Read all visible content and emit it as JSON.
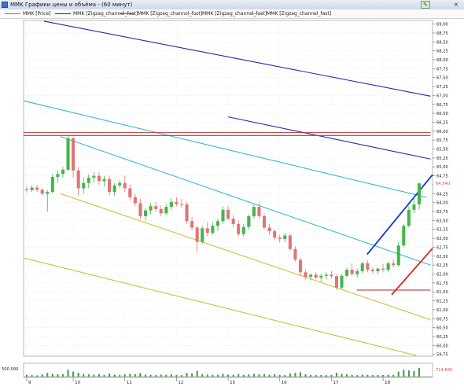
{
  "window": {
    "title": "MMK Графики цены и объёма - (60 минут)",
    "close_glyph": "×"
  },
  "legend": [
    {
      "label": "MMK [Price]",
      "color": "#7f7f7f"
    },
    {
      "label": "MMK [Zigzag_channel_fast]",
      "color": "#1f2aa8"
    },
    {
      "label": "MMK [Zigzag_channel_fast]",
      "color": "#b73737"
    },
    {
      "label": "MMK [Zigzag_channel_fast]",
      "color": "#c9c23a"
    },
    {
      "label": "MMK [Zigzag_channel_fast]",
      "color": "#3ab8c9"
    }
  ],
  "colors": {
    "up_candle": "#43b64a",
    "down_candle": "#e07478",
    "blue_line": "#1f2aa8",
    "blue_trend": "#1339c8",
    "teal_line": "#3ab8c9",
    "yellow_line": "#c9c23a",
    "red_line": "#b73737",
    "red_trend": "#e02121",
    "volume": "#3f9a45",
    "price_badge": "#e84a4a",
    "grid": "#d9d9d9"
  },
  "chart_data": {
    "type": "candlestick",
    "title": "MMK Графики цены и объёма - (60 минут)",
    "x_tick_labels": [
      "9",
      "10",
      "11",
      "12",
      "15",
      "16",
      "17",
      "18"
    ],
    "ylim": [
      59.7,
      69.1
    ],
    "y_tick_labels": [
      "69,00",
      "68,75",
      "68,50",
      "68,25",
      "68,00",
      "67,75",
      "67,50",
      "67,25",
      "67,00",
      "66,75",
      "66,50",
      "66,25",
      "66,00",
      "65,75",
      "65,50",
      "65,25",
      "65,00",
      "64,75",
      "64,50",
      "64,25",
      "64,00",
      "63,75",
      "63,50",
      "63,25",
      "63,00",
      "62,75",
      "62,50",
      "62,25",
      "62,00",
      "61,75",
      "61,50",
      "61,25",
      "61,00",
      "60,75",
      "60,50",
      "60,25",
      "60,00",
      "59,75"
    ],
    "last_price_label": "64,540",
    "candles": {
      "day_label_at_index": [
        0,
        9,
        19,
        29,
        39,
        49,
        59,
        69
      ],
      "ohlc": [
        [
          64.38,
          64.45,
          64.28,
          64.35
        ],
        [
          64.35,
          64.48,
          64.3,
          64.42
        ],
        [
          64.42,
          64.5,
          64.3,
          64.36
        ],
        [
          64.36,
          64.4,
          64.2,
          64.25
        ],
        [
          64.25,
          64.35,
          63.75,
          64.3
        ],
        [
          64.3,
          64.8,
          64.25,
          64.72
        ],
        [
          64.72,
          64.9,
          64.55,
          64.8
        ],
        [
          64.8,
          65.0,
          64.7,
          64.92
        ],
        [
          64.92,
          65.9,
          64.9,
          65.8
        ],
        [
          65.8,
          65.85,
          64.7,
          64.9
        ],
        [
          64.9,
          65.0,
          64.2,
          64.4
        ],
        [
          64.4,
          64.7,
          64.25,
          64.55
        ],
        [
          64.55,
          64.8,
          64.4,
          64.7
        ],
        [
          64.7,
          64.85,
          64.55,
          64.75
        ],
        [
          64.75,
          64.85,
          64.5,
          64.6
        ],
        [
          64.6,
          64.75,
          64.45,
          64.66
        ],
        [
          64.66,
          64.75,
          64.2,
          64.3
        ],
        [
          64.3,
          64.55,
          64.2,
          64.48
        ],
        [
          64.48,
          64.62,
          64.4,
          64.55
        ],
        [
          64.55,
          64.75,
          64.3,
          64.4
        ],
        [
          64.4,
          64.5,
          64.05,
          64.15
        ],
        [
          64.15,
          64.25,
          63.9,
          63.98
        ],
        [
          63.98,
          64.1,
          63.55,
          63.62
        ],
        [
          63.62,
          63.85,
          63.5,
          63.78
        ],
        [
          63.78,
          63.98,
          63.68,
          63.9
        ],
        [
          63.9,
          64.02,
          63.75,
          63.82
        ],
        [
          63.82,
          63.92,
          63.62,
          63.7
        ],
        [
          63.7,
          63.95,
          63.65,
          63.88
        ],
        [
          63.88,
          64.12,
          63.8,
          64.02
        ],
        [
          64.02,
          64.15,
          63.9,
          63.96
        ],
        [
          63.96,
          64.1,
          63.85,
          63.95
        ],
        [
          63.95,
          64.02,
          63.4,
          63.48
        ],
        [
          63.48,
          63.6,
          63.22,
          63.3
        ],
        [
          63.3,
          63.35,
          62.6,
          62.9
        ],
        [
          62.9,
          63.35,
          62.85,
          63.28
        ],
        [
          63.28,
          63.45,
          63.05,
          63.15
        ],
        [
          63.15,
          63.45,
          63.1,
          63.35
        ],
        [
          63.35,
          63.55,
          63.2,
          63.48
        ],
        [
          63.48,
          63.9,
          63.4,
          63.8
        ],
        [
          63.8,
          63.9,
          63.5,
          63.55
        ],
        [
          63.55,
          63.65,
          63.3,
          63.4
        ],
        [
          63.4,
          63.5,
          63.05,
          63.12
        ],
        [
          63.12,
          63.4,
          63.05,
          63.32
        ],
        [
          63.32,
          63.68,
          63.25,
          63.62
        ],
        [
          63.62,
          63.95,
          63.55,
          63.88
        ],
        [
          63.88,
          64.0,
          63.55,
          63.62
        ],
        [
          63.62,
          63.7,
          63.25,
          63.3
        ],
        [
          63.3,
          63.4,
          63.1,
          63.2
        ],
        [
          63.2,
          63.25,
          62.95,
          63.02
        ],
        [
          63.02,
          63.1,
          62.88,
          62.98
        ],
        [
          62.98,
          63.15,
          62.9,
          63.08
        ],
        [
          63.08,
          63.15,
          62.65,
          62.7
        ],
        [
          62.7,
          62.78,
          62.35,
          62.4
        ],
        [
          62.4,
          62.45,
          61.95,
          62.05
        ],
        [
          62.05,
          62.12,
          61.85,
          61.92
        ],
        [
          61.92,
          62.02,
          61.82,
          61.98
        ],
        [
          61.98,
          62.05,
          61.85,
          61.9
        ],
        [
          61.9,
          62.0,
          61.78,
          61.95
        ],
        [
          61.95,
          62.05,
          61.85,
          61.98
        ],
        [
          61.98,
          62.08,
          61.88,
          61.94
        ],
        [
          61.94,
          62.0,
          61.55,
          61.62
        ],
        [
          61.62,
          62.0,
          61.58,
          61.95
        ],
        [
          61.95,
          62.18,
          61.9,
          62.12
        ],
        [
          62.12,
          62.3,
          61.95,
          62.0
        ],
        [
          62.0,
          62.15,
          61.9,
          62.08
        ],
        [
          62.08,
          62.35,
          62.02,
          62.3
        ],
        [
          62.3,
          62.38,
          62.05,
          62.12
        ],
        [
          62.12,
          62.2,
          62.02,
          62.08
        ],
        [
          62.08,
          62.18,
          62.0,
          62.15
        ],
        [
          62.15,
          62.28,
          62.05,
          62.12
        ],
        [
          62.12,
          62.35,
          62.05,
          62.3
        ],
        [
          62.3,
          62.42,
          62.18,
          62.25
        ],
        [
          62.25,
          62.9,
          62.2,
          62.8
        ],
        [
          62.8,
          63.4,
          62.75,
          63.35
        ],
        [
          63.35,
          63.9,
          63.3,
          63.8
        ],
        [
          63.8,
          64.15,
          63.7,
          63.95
        ],
        [
          63.95,
          64.55,
          63.8,
          64.54
        ]
      ],
      "volume": [
        0.15,
        0.12,
        0.1,
        0.18,
        0.3,
        0.22,
        0.18,
        0.2,
        0.55,
        0.4,
        0.3,
        0.22,
        0.18,
        0.15,
        0.2,
        0.14,
        0.25,
        0.16,
        0.14,
        0.18,
        0.22,
        0.2,
        0.28,
        0.16,
        0.14,
        0.12,
        0.16,
        0.15,
        0.18,
        0.14,
        0.12,
        0.3,
        0.25,
        0.45,
        0.2,
        0.16,
        0.15,
        0.14,
        0.22,
        0.16,
        0.15,
        0.2,
        0.14,
        0.18,
        0.22,
        0.18,
        0.2,
        0.15,
        0.18,
        0.14,
        0.12,
        0.25,
        0.3,
        0.35,
        0.18,
        0.14,
        0.12,
        0.13,
        0.12,
        0.14,
        0.3,
        0.22,
        0.18,
        0.14,
        0.12,
        0.16,
        0.14,
        0.12,
        0.12,
        0.13,
        0.15,
        0.14,
        0.4,
        0.55,
        0.5,
        0.45,
        0.7
      ],
      "volume_tick_label": "500 000",
      "volume_last_label": "714 840"
    },
    "lines": [
      {
        "color": "#1f2aa8",
        "x0": 0.05,
        "y0": 69.08,
        "x1": 0.995,
        "y1": 66.98
      },
      {
        "color": "#1f2aa8",
        "x0": 0.5,
        "y0": 66.4,
        "x1": 0.995,
        "y1": 65.22
      },
      {
        "color": "#3ab8c9",
        "x0": 0.0,
        "y0": 66.85,
        "x1": 0.985,
        "y1": 64.15
      },
      {
        "color": "#3ab8c9",
        "x0": 0.09,
        "y0": 65.85,
        "x1": 0.995,
        "y1": 62.25
      },
      {
        "color": "#c9c23a",
        "x0": 0.09,
        "y0": 64.25,
        "x1": 0.995,
        "y1": 60.72
      },
      {
        "color": "#c9c23a",
        "x0": 0.0,
        "y0": 62.45,
        "x1": 0.96,
        "y1": 59.72
      },
      {
        "color": "#b73737",
        "x0": 0.0,
        "y0": 65.96,
        "x1": 0.995,
        "y1": 65.96
      },
      {
        "color": "#b73737",
        "x0": 0.0,
        "y0": 65.88,
        "x1": 0.995,
        "y1": 65.88
      },
      {
        "color": "#b73737",
        "x0": 0.815,
        "y0": 61.55,
        "x1": 0.995,
        "y1": 61.55
      },
      {
        "color": "#1339c8",
        "x0": 0.84,
        "y0": 62.55,
        "x1": 1.0,
        "y1": 64.78
      },
      {
        "color": "#e02121",
        "x0": 0.9,
        "y0": 61.42,
        "x1": 1.0,
        "y1": 62.72
      }
    ]
  }
}
